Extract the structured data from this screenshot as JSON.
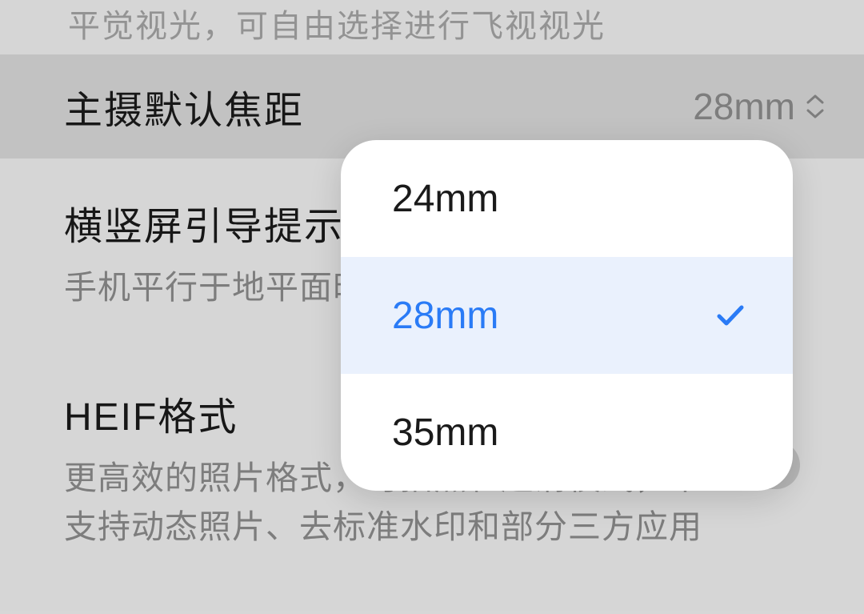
{
  "settings": {
    "faded_top_text": "平觉视光，可自由选择进行飞视视光",
    "focal": {
      "title": "主摄默认焦距",
      "value": "28mm"
    },
    "orientation": {
      "title": "横竖屏引导提示",
      "desc": "手机平行于地平面时，出照片方向的提示，支"
    },
    "heif": {
      "title": "HEIF格式",
      "desc": "更高效的照片格式，可拍照和超清模式，不支持动态照片、去标准水印和部分三方应用"
    }
  },
  "focal_menu": {
    "options": [
      {
        "label": "24mm",
        "selected": false
      },
      {
        "label": "28mm",
        "selected": true
      },
      {
        "label": "35mm",
        "selected": false
      }
    ]
  }
}
